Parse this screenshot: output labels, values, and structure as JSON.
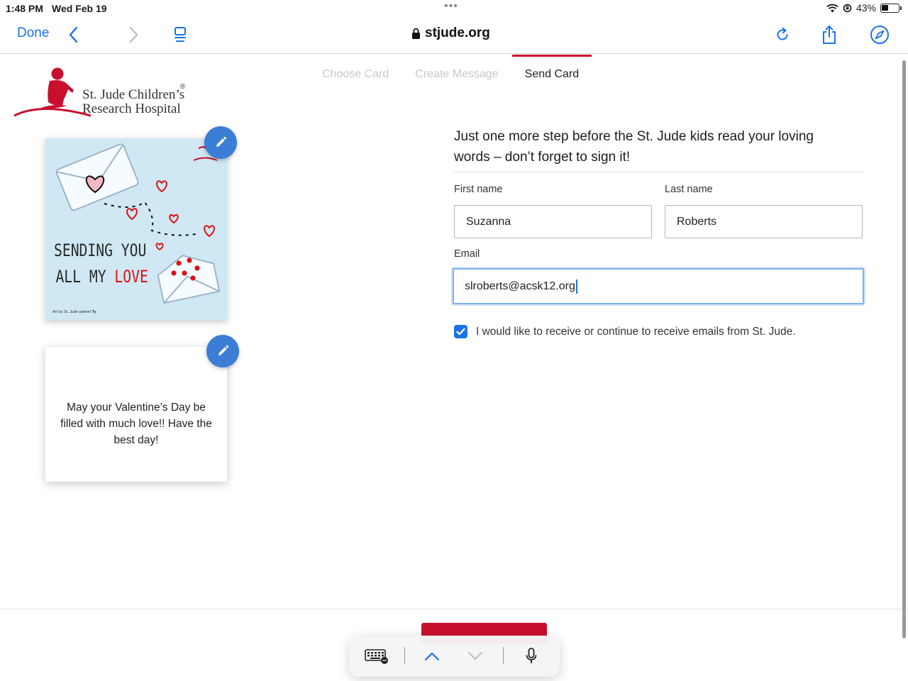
{
  "status_bar": {
    "time": "1:48 PM",
    "date": "Wed Feb 19",
    "battery": "43%",
    "battery_level": 0.43
  },
  "browser": {
    "done_label": "Done",
    "url": "stjude.org"
  },
  "logo": {
    "line1": "St. Jude Children’s",
    "line2": "Research Hospital",
    "reg": "®"
  },
  "steps": [
    {
      "label": "Choose Card"
    },
    {
      "label": "Create Message"
    },
    {
      "label": "Send Card"
    }
  ],
  "card": {
    "front_title_line1": "SENDING YOU",
    "front_title_line2a": "ALL MY ",
    "front_title_line2b": "LOVE",
    "front_credit": "Art by St. Jude patient",
    "front_credit_name": "Ty",
    "message": "May your Valentine’s Day be filled with much love!! Have the best day!"
  },
  "form": {
    "heading": "Just one more step before the St. Jude kids read your loving words – don’t forget to sign it!",
    "first_name_label": "First name",
    "first_name_value": "Suzanna",
    "last_name_label": "Last name",
    "last_name_value": "Roberts",
    "email_label": "Email",
    "email_value": "slroberts@acsk12.org",
    "optin_label": "I would like to receive or continue to receive emails from St. Jude.",
    "optin_checked": true
  },
  "colors": {
    "accent": "#1a73e8",
    "brand": "#c8102e",
    "edit": "#3c7dd6"
  }
}
